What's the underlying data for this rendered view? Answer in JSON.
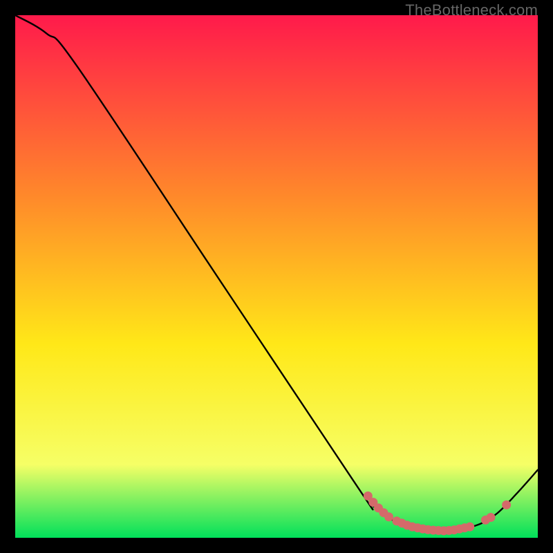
{
  "watermark": "TheBottleneck.com",
  "colors": {
    "bg": "#000000",
    "grad_top": "#ff1a4b",
    "grad_mid1": "#ff8a2a",
    "grad_mid2": "#ffe818",
    "grad_mid3": "#f6ff66",
    "grad_bottom": "#00e05a",
    "line": "#000000",
    "marker": "#d46a6a"
  },
  "chart_data": {
    "type": "line",
    "xlim": [
      0,
      100
    ],
    "ylim": [
      0,
      100
    ],
    "title": "",
    "xlabel": "",
    "ylabel": "",
    "curve": [
      {
        "x": 0,
        "y": 100
      },
      {
        "x": 6,
        "y": 96.5
      },
      {
        "x": 12,
        "y": 90
      },
      {
        "x": 40,
        "y": 48
      },
      {
        "x": 66,
        "y": 9
      },
      {
        "x": 68,
        "y": 6.5
      },
      {
        "x": 72,
        "y": 3.5
      },
      {
        "x": 76,
        "y": 2
      },
      {
        "x": 82,
        "y": 1.3
      },
      {
        "x": 88,
        "y": 2.3
      },
      {
        "x": 92,
        "y": 4.5
      },
      {
        "x": 96,
        "y": 8.5
      },
      {
        "x": 100,
        "y": 13
      }
    ],
    "markers": [
      {
        "x": 67.5,
        "y": 8.0
      },
      {
        "x": 68.5,
        "y": 6.8
      },
      {
        "x": 69.5,
        "y": 5.7
      },
      {
        "x": 70.5,
        "y": 4.8
      },
      {
        "x": 71.5,
        "y": 4.0
      },
      {
        "x": 73.0,
        "y": 3.2
      },
      {
        "x": 74.0,
        "y": 2.8
      },
      {
        "x": 75.0,
        "y": 2.4
      },
      {
        "x": 76.0,
        "y": 2.1
      },
      {
        "x": 77.0,
        "y": 1.9
      },
      {
        "x": 78.0,
        "y": 1.7
      },
      {
        "x": 79.0,
        "y": 1.55
      },
      {
        "x": 80.0,
        "y": 1.45
      },
      {
        "x": 81.0,
        "y": 1.4
      },
      {
        "x": 82.0,
        "y": 1.35
      },
      {
        "x": 83.0,
        "y": 1.4
      },
      {
        "x": 84.0,
        "y": 1.5
      },
      {
        "x": 85.0,
        "y": 1.7
      },
      {
        "x": 86.0,
        "y": 1.9
      },
      {
        "x": 87.0,
        "y": 2.1
      },
      {
        "x": 90.0,
        "y": 3.4
      },
      {
        "x": 91.0,
        "y": 3.9
      },
      {
        "x": 94.0,
        "y": 6.3
      }
    ]
  }
}
